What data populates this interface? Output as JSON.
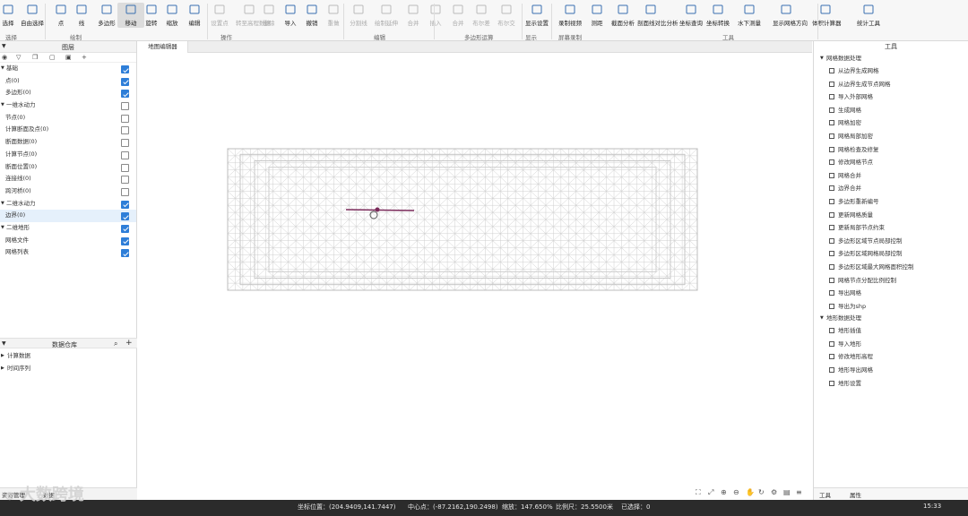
{
  "ribbon": {
    "tools": [
      {
        "label": "选择",
        "icon": "cursor-icon",
        "enabled": true
      },
      {
        "label": "自由选择",
        "icon": "free-select-icon",
        "enabled": true
      },
      {
        "label": "点",
        "icon": "point-icon",
        "enabled": true
      },
      {
        "label": "线",
        "icon": "line-icon",
        "enabled": true
      },
      {
        "label": "多边形",
        "icon": "polygon-icon",
        "enabled": true
      },
      {
        "label": "移动",
        "icon": "move-icon",
        "enabled": true,
        "selected": true
      },
      {
        "label": "旋转",
        "icon": "rotate-icon",
        "enabled": true
      },
      {
        "label": "缩放",
        "icon": "scale-icon",
        "enabled": true
      },
      {
        "label": "编辑",
        "icon": "edit-icon",
        "enabled": true
      },
      {
        "label": "设置点",
        "icon": "set-point-icon",
        "enabled": false
      },
      {
        "label": "转至高程数据",
        "icon": "convert-icon",
        "enabled": false
      },
      {
        "label": "删除",
        "icon": "delete-icon",
        "enabled": false
      },
      {
        "label": "导入",
        "icon": "import-icon",
        "enabled": true
      },
      {
        "label": "撤销",
        "icon": "undo-icon",
        "enabled": true
      },
      {
        "label": "重做",
        "icon": "redo-icon",
        "enabled": false
      },
      {
        "label": "分割线",
        "icon": "split-line-icon",
        "enabled": false
      },
      {
        "label": "绘制延伸",
        "icon": "extend-icon",
        "enabled": false
      },
      {
        "label": "合并",
        "icon": "merge-icon",
        "enabled": false
      },
      {
        "label": "插入",
        "icon": "insert-icon",
        "enabled": false
      },
      {
        "label": "合并",
        "icon": "merge2-icon",
        "enabled": false
      },
      {
        "label": "布尔差",
        "icon": "boolean-icon",
        "enabled": false
      },
      {
        "label": "布尔交",
        "icon": "intersect-icon",
        "enabled": false
      },
      {
        "label": "显示设置",
        "icon": "display-icon",
        "enabled": true
      },
      {
        "label": "录制视频",
        "icon": "video-icon",
        "enabled": true
      },
      {
        "label": "测距",
        "icon": "ruler-icon",
        "enabled": true
      },
      {
        "label": "截面分析",
        "icon": "section-icon",
        "enabled": true
      },
      {
        "label": "剖面线对比分析",
        "icon": "profile-icon",
        "enabled": true
      },
      {
        "label": "坐标查询",
        "icon": "coord-icon",
        "enabled": true
      },
      {
        "label": "坐标转换",
        "icon": "coord-convert-icon",
        "enabled": true
      },
      {
        "label": "水下测量",
        "icon": "underwater-icon",
        "enabled": true
      },
      {
        "label": "显示网格方向",
        "icon": "grid-dir-icon",
        "enabled": true
      },
      {
        "label": "体积计算器",
        "icon": "volume-icon",
        "enabled": true
      },
      {
        "label": "统计工具",
        "icon": "stats-icon",
        "enabled": true
      }
    ],
    "groups": [
      "选择",
      "绘制",
      "操作",
      "编辑",
      "多边形运算",
      "显示",
      "屏幕录制",
      "工具"
    ]
  },
  "left": {
    "layers_title": "图层",
    "tree": [
      {
        "label": "基础",
        "level": 0,
        "expanded": true,
        "checked": true
      },
      {
        "label": "点(0)",
        "level": 1,
        "checked": true
      },
      {
        "label": "多边形(0)",
        "level": 1,
        "checked": true
      },
      {
        "label": "一维水动力",
        "level": 0,
        "expanded": true,
        "checked": false
      },
      {
        "label": "节点(0)",
        "level": 1,
        "checked": false
      },
      {
        "label": "计算断面及点(0)",
        "level": 1,
        "checked": false
      },
      {
        "label": "断面数据(0)",
        "level": 1,
        "checked": false
      },
      {
        "label": "计算节点(0)",
        "level": 1,
        "checked": false
      },
      {
        "label": "断面位置(0)",
        "level": 1,
        "checked": false
      },
      {
        "label": "连接线(0)",
        "level": 1,
        "checked": false
      },
      {
        "label": "跨河桥(0)",
        "level": 1,
        "checked": false
      },
      {
        "label": "二维水动力",
        "level": 0,
        "expanded": true,
        "checked": true
      },
      {
        "label": "边界(0)",
        "level": 1,
        "checked": true,
        "highlighted": true
      },
      {
        "label": "二维地形",
        "level": 0,
        "expanded": true,
        "checked": true
      },
      {
        "label": "网格文件",
        "level": 1,
        "checked": true
      },
      {
        "label": "网格列表",
        "level": 1,
        "checked": true
      }
    ],
    "library_title": "数据仓库",
    "library": [
      "计算数据",
      "时间序列"
    ],
    "bottom_tabs": [
      "资源管理",
      "数据"
    ]
  },
  "viewport": {
    "tab": "地图编辑器"
  },
  "right": {
    "title": "工具",
    "sections": [
      {
        "label": "网格数据处理",
        "items": [
          "从边界生成网格",
          "从边界生成节点网格",
          "导入外部网格",
          "生成网格",
          "网格加密",
          "网格局部加密",
          "网格检查及修复",
          "修改网格节点",
          "网格合并",
          "边界合并",
          "多边形重新编号",
          "更新网格质量",
          "更新局部节点约束",
          "多边形区域节点局部控制",
          "多边形区域网格局部控制",
          "多边形区域最大网格面积控制",
          "网格节点分配比例控制",
          "导出网格",
          "导出为shp"
        ]
      },
      {
        "label": "地形数据处理",
        "items": [
          "地形插值",
          "导入地形",
          "修改地形高程",
          "地形导出网格",
          "地形设置"
        ]
      }
    ],
    "bottom_tabs": [
      "工具",
      "属性"
    ]
  },
  "statusbar": {
    "cursor": "坐标位置：(204.9409,141.7447)",
    "center": "中心点：(-87.2162,190.2498)",
    "zoom": "缩放：147.650%",
    "scale": "比例尺：25.5500米",
    "selected": "已选择：0",
    "time": "15:33"
  },
  "watermark": "大数跨境"
}
